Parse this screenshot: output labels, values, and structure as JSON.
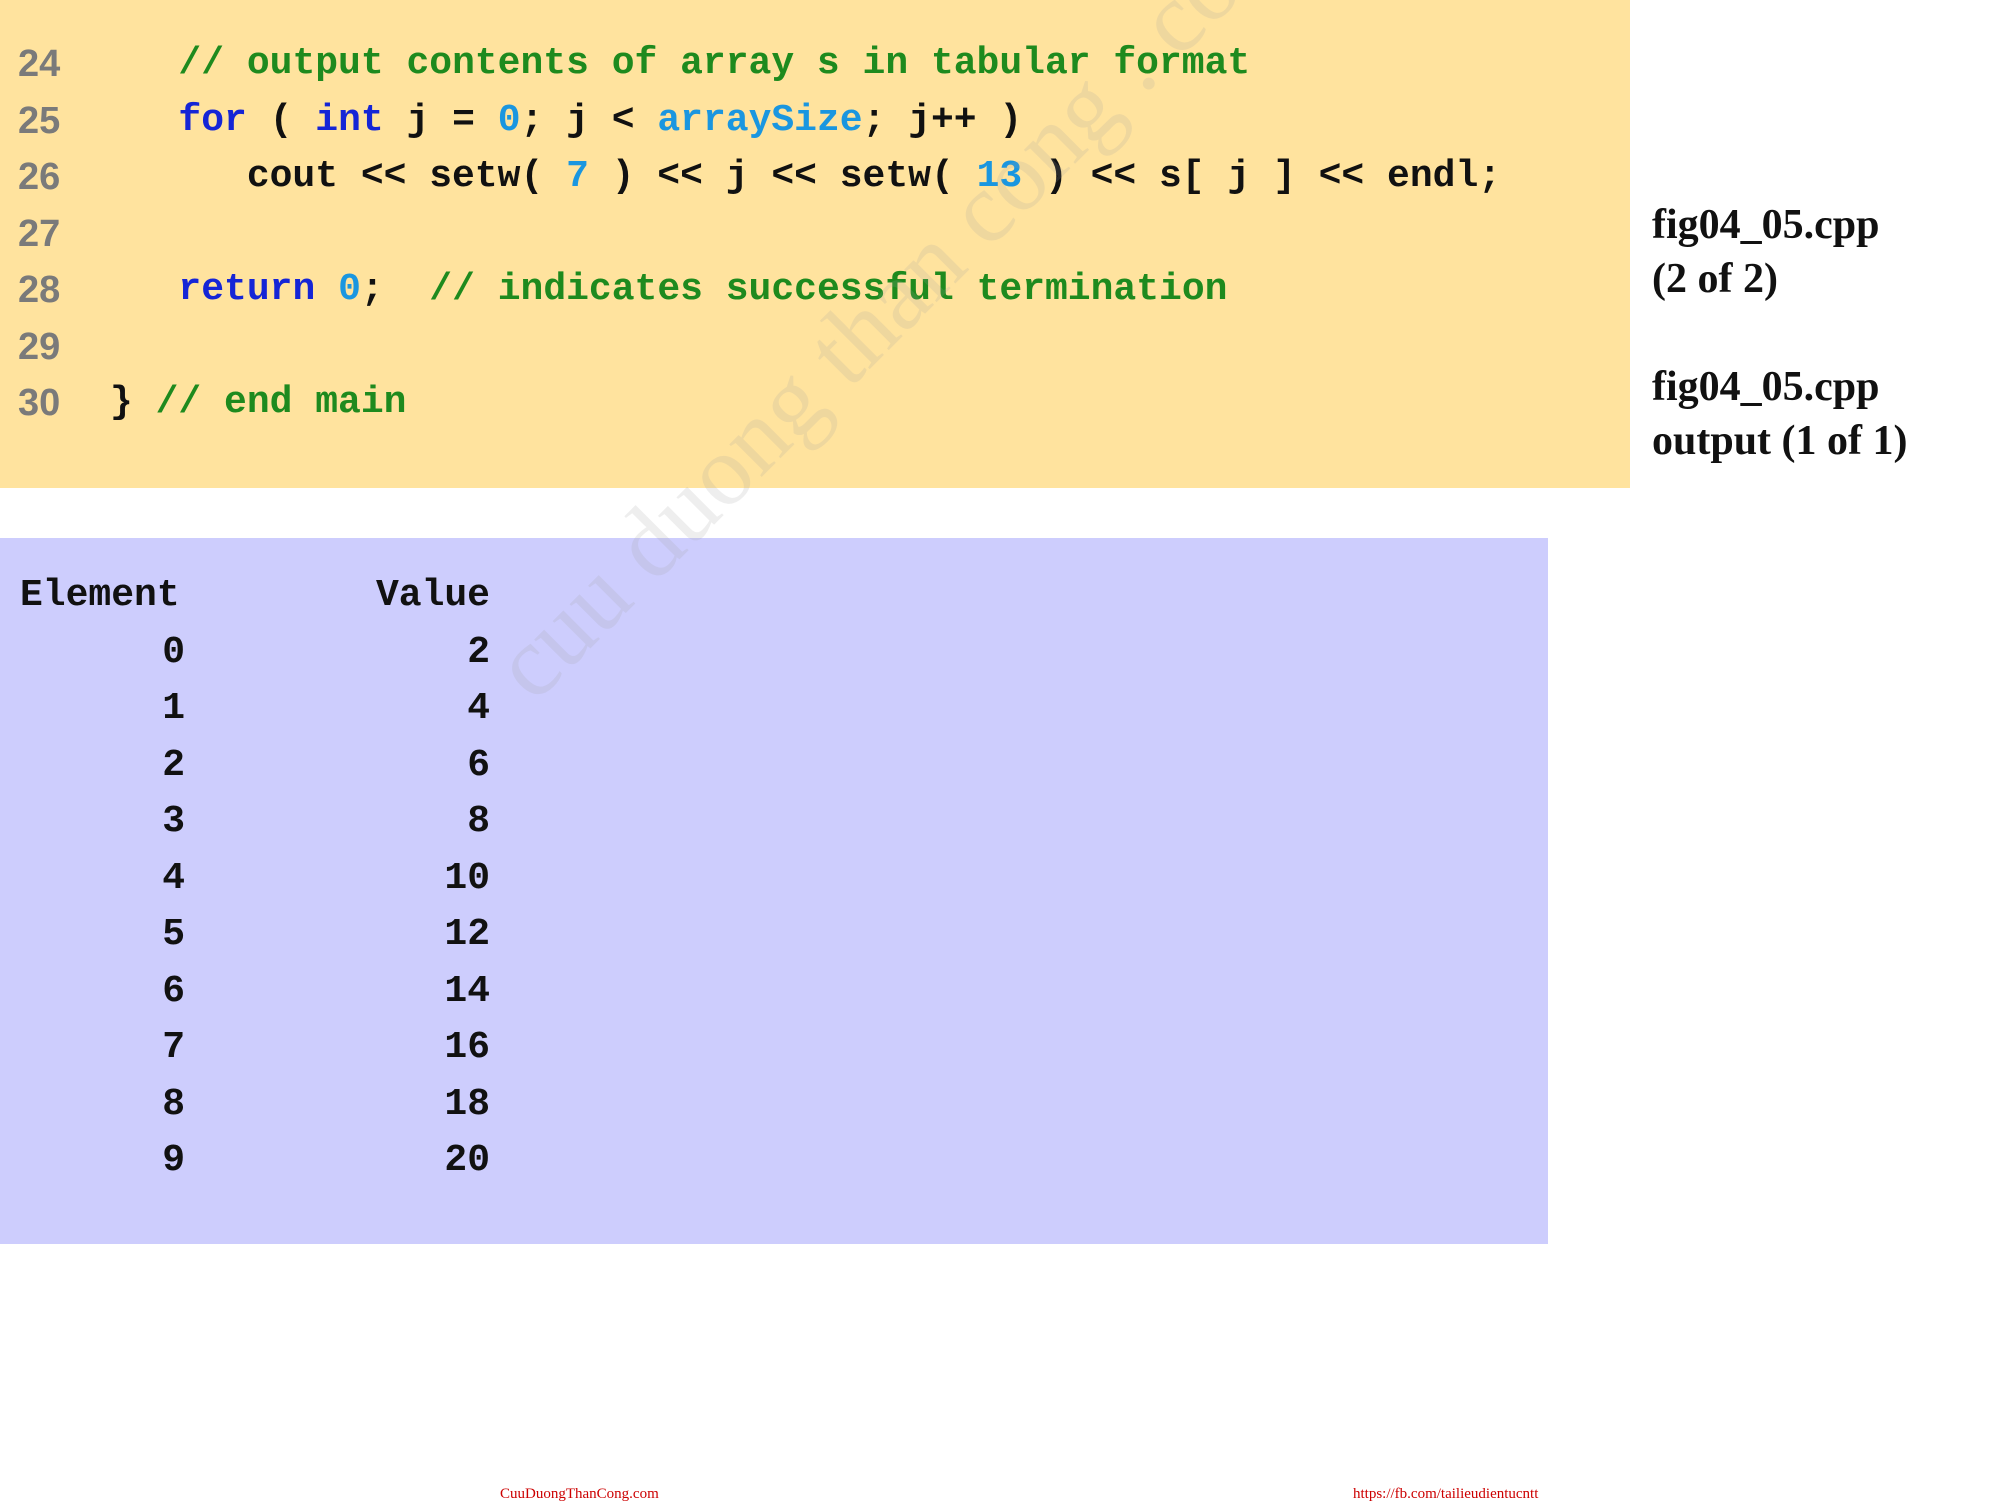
{
  "code": {
    "lines": [
      {
        "number": "24",
        "tokens": [
          {
            "type": "plain",
            "text": "   "
          },
          {
            "type": "comment",
            "text": "// output contents of array s in tabular format"
          }
        ]
      },
      {
        "number": "25",
        "tokens": [
          {
            "type": "plain",
            "text": "   "
          },
          {
            "type": "keyword",
            "text": "for"
          },
          {
            "type": "plain",
            "text": " ( "
          },
          {
            "type": "keyword",
            "text": "int"
          },
          {
            "type": "plain",
            "text": " j = "
          },
          {
            "type": "number",
            "text": "0"
          },
          {
            "type": "plain",
            "text": "; j < "
          },
          {
            "type": "ident",
            "text": "arraySize"
          },
          {
            "type": "plain",
            "text": "; j++ )"
          }
        ]
      },
      {
        "number": "26",
        "tokens": [
          {
            "type": "plain",
            "text": "      cout << setw( "
          },
          {
            "type": "number",
            "text": "7"
          },
          {
            "type": "plain",
            "text": " ) << j << setw( "
          },
          {
            "type": "number",
            "text": "13"
          },
          {
            "type": "plain",
            "text": " ) << s[ j ] << endl;"
          }
        ]
      },
      {
        "number": "27",
        "tokens": []
      },
      {
        "number": "28",
        "tokens": [
          {
            "type": "plain",
            "text": "   "
          },
          {
            "type": "keyword",
            "text": "return"
          },
          {
            "type": "plain",
            "text": " "
          },
          {
            "type": "number",
            "text": "0"
          },
          {
            "type": "plain",
            "text": ";  "
          },
          {
            "type": "comment",
            "text": "// indicates successful termination"
          }
        ]
      },
      {
        "number": "29",
        "tokens": []
      },
      {
        "number": "30",
        "tokens": [
          {
            "type": "plain",
            "text": "} "
          },
          {
            "type": "comment",
            "text": "// end main"
          }
        ]
      }
    ]
  },
  "side_notes": {
    "file1": "fig04_05.cpp",
    "part1": "(2 of 2)",
    "file2": "fig04_05.cpp",
    "part2": "output (1 of 1)"
  },
  "output": {
    "header": {
      "element": "Element",
      "value": "Value"
    },
    "rows": [
      {
        "element": "0",
        "value": "2"
      },
      {
        "element": "1",
        "value": "4"
      },
      {
        "element": "2",
        "value": "6"
      },
      {
        "element": "3",
        "value": "8"
      },
      {
        "element": "4",
        "value": "10"
      },
      {
        "element": "5",
        "value": "12"
      },
      {
        "element": "6",
        "value": "14"
      },
      {
        "element": "7",
        "value": "16"
      },
      {
        "element": "8",
        "value": "18"
      },
      {
        "element": "9",
        "value": "20"
      }
    ]
  },
  "watermark": "cuu duong than cong . com",
  "footer": {
    "left": "CuuDuongThanCong.com",
    "right": "https://fb.com/tailieudientucntt"
  }
}
